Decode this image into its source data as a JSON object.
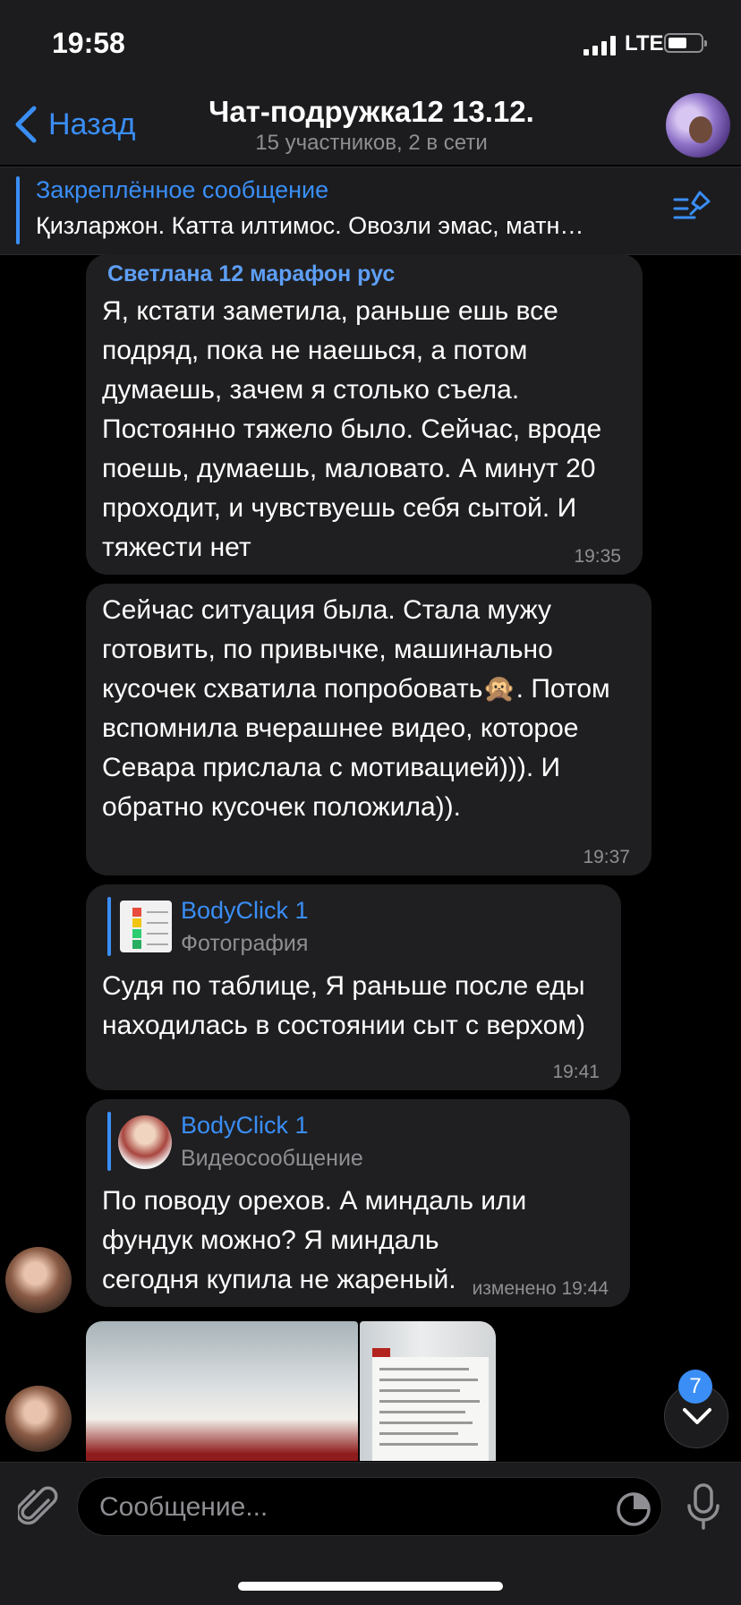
{
  "status": {
    "time": "19:58",
    "network": "LTE"
  },
  "nav": {
    "back_label": "Назад",
    "title": "Чат-подружка12 13.12.",
    "subtitle": "15 участников, 2 в сети"
  },
  "pinned": {
    "title": "Закреплённое сообщение",
    "text": "Қизларжон. Катта илтимос. Овозли эмас, матн…"
  },
  "messages": [
    {
      "sender": "Светлана 12 марафон рус",
      "text": "Я, кстати заметила, раньше ешь все подряд, пока не наешься, а потом думаешь, зачем я столько съела. Постоянно тяжело было. Сейчас, вроде поешь, думаешь, маловато. А минут 20 проходит, и чувствуешь себя сытой. И тяжести нет",
      "time": "19:35"
    },
    {
      "text": "Сейчас ситуация была. Стала мужу готовить, по привычке, машинально кусочек схватила попробовать🙊. Потом вспомнила вчерашнее видео, которое Севара прислала с мотивацией))). И обратно кусочек положила)).",
      "time": "19:37"
    },
    {
      "reply_name": "BodyClick 1",
      "reply_type": "Фотография",
      "text": "Судя по таблице, Я раньше после еды находилась в состоянии сыт с верхом)",
      "time": "19:41"
    },
    {
      "reply_name": "BodyClick 1",
      "reply_type": "Видеосообщение",
      "text": "По поводу орехов. А миндаль или фундук можно? Я миндаль сегодня купила не жареный.",
      "time": "изменено 19:44"
    }
  ],
  "scroll": {
    "unread_count": "7"
  },
  "input": {
    "placeholder": "Сообщение..."
  },
  "colors": {
    "accent": "#3a8ef6",
    "bubble": "#1f1f21",
    "background": "#000000"
  }
}
